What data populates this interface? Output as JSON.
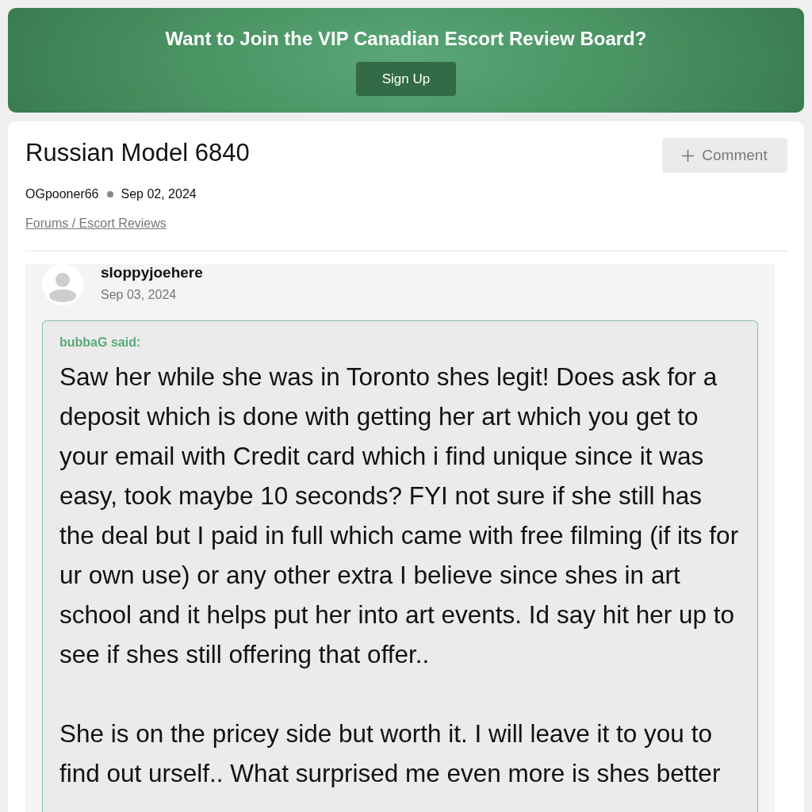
{
  "banner": {
    "title": "Want to Join the VIP Canadian Escort Review Board?",
    "button": "Sign Up"
  },
  "thread": {
    "title": "Russian Model 6840",
    "comment_button": "Comment",
    "author": "OGpooner66",
    "date": "Sep 02, 2024",
    "breadcrumb": "Forums / Escort Reviews"
  },
  "post": {
    "author": "sloppyjoehere",
    "date": "Sep 03, 2024",
    "quote": {
      "attribution": "bubbaG said:",
      "paragraphs": [
        "Saw her while she was in Toronto shes legit! Does ask for a deposit which is done with getting her art which you get to your email with Credit card which i find unique since it was easy, took maybe 10 seconds? FYI not sure if she still has the deal but I paid in full which came with free filming (if its for ur own use) or any other extra I believe since shes in art school and it helps put her into art events. Id say hit her up to see if shes still offering that offer..",
        "She is on the pricey side but worth it. I will leave it to you to find out urself.. What surprised me even more is shes better"
      ]
    }
  }
}
